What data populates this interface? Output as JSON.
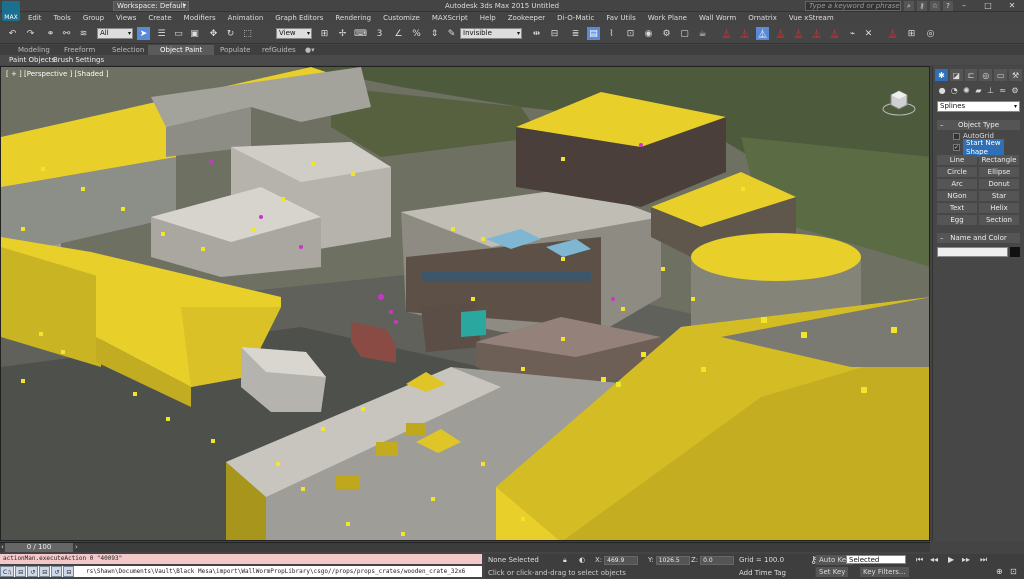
{
  "titlebar": {
    "logo_text": "MAX",
    "workspace": "Workspace: Default",
    "app_title": "Autodesk 3ds Max  2015      Untitled",
    "search_placeholder": "Type a keyword or phrase"
  },
  "menu": [
    "Edit",
    "Tools",
    "Group",
    "Views",
    "Create",
    "Modifiers",
    "Animation",
    "Graph Editors",
    "Rendering",
    "Customize",
    "MAXScript",
    "Help",
    "Zookeeper",
    "Di-O-Matic",
    "Fav Utils",
    "Work Plane",
    "Wall Worm",
    "Ornatrix",
    "Vue xStream"
  ],
  "toolbar": {
    "filter_select": "All",
    "reference_coord": "View",
    "named_selection": "Invisible"
  },
  "ribbon": {
    "tabs": [
      "Modeling",
      "Freeform",
      "Selection",
      "Object Paint",
      "Populate",
      "refGuides"
    ],
    "active_tab": "Object Paint",
    "sub_items": [
      "Paint Objects",
      "Brush Settings"
    ]
  },
  "viewport": {
    "label": "[ + ] [Perspective ] [Shaded ]"
  },
  "command_panel": {
    "category": "Splines",
    "object_type_title": "Object Type",
    "autogrid": "AutoGrid",
    "start_new_shape": "Start New Shape",
    "buttons": [
      "Line",
      "Rectangle",
      "Circle",
      "Ellipse",
      "Arc",
      "Donut",
      "NGon",
      "Star",
      "Text",
      "Helix",
      "Egg",
      "Section"
    ],
    "name_color_title": "Name and Color"
  },
  "timeline": {
    "frame": "0 / 100"
  },
  "maxscript": {
    "listener": "actionMan.executeAction 0 \"40093\"",
    "path": "rs\\Shawn\\Documents\\Vault\\Black Mesa\\import\\WallWormPropLibrary\\csgo//props/props_crates/wooden_crate_32x6"
  },
  "status": {
    "selection": "None Selected",
    "hint": "Click or click-and-drag to select objects",
    "x_label": "X:",
    "x_value": "469.9",
    "y_label": "Y:",
    "y_value": "1026.5",
    "z_label": "Z:",
    "z_value": "0.0",
    "grid": "Grid = 100.0",
    "add_time_tag": "Add Time Tag"
  },
  "animation": {
    "auto_key": "Auto Key",
    "selected": "Selected",
    "set_key": "Set Key",
    "key_filters": "Key Filters..."
  },
  "colors": {
    "accent_blue": "#2f6fb5",
    "roof_yellow": "#e8cf2a",
    "listener_pink": "#f4c8c8"
  }
}
